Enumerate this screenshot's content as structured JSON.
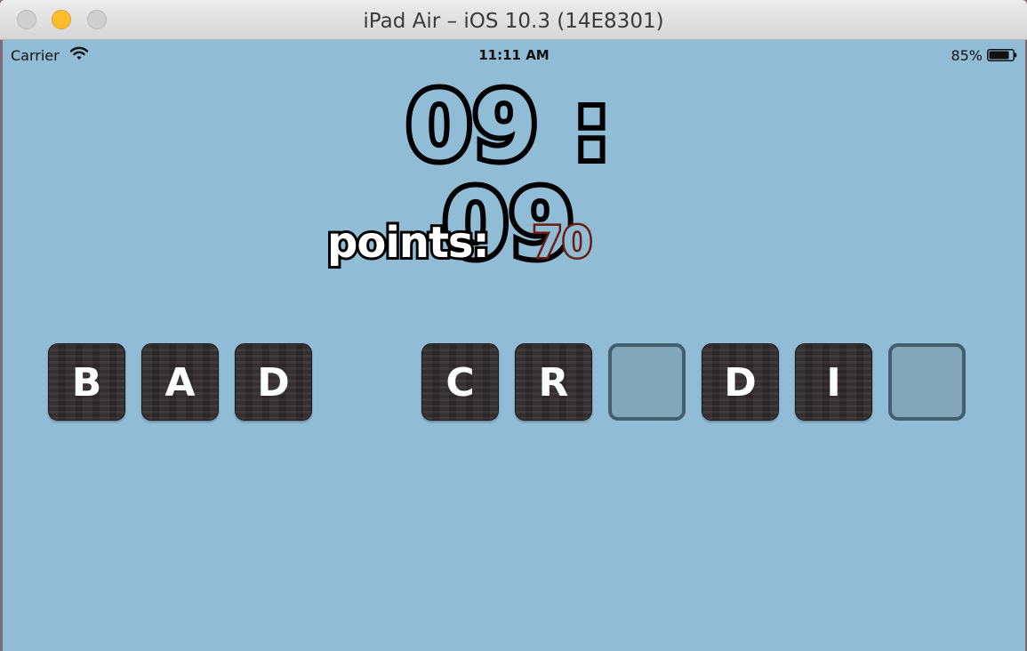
{
  "window": {
    "title": "iPad Air – iOS 10.3 (14E8301)"
  },
  "status_bar": {
    "carrier": "Carrier",
    "time": "11:11 AM",
    "battery": "85%",
    "battery_level": 0.85
  },
  "game": {
    "timer": "09 : 09",
    "points_label": "points:",
    "points_value": "70",
    "source_tiles": [
      {
        "letter": "B"
      },
      {
        "letter": "A"
      },
      {
        "letter": "D"
      }
    ],
    "target_tiles": [
      {
        "letter": "C",
        "filled": true
      },
      {
        "letter": "R",
        "filled": true
      },
      {
        "letter": "",
        "filled": false
      },
      {
        "letter": "D",
        "filled": true
      },
      {
        "letter": "I",
        "filled": true
      },
      {
        "letter": "",
        "filled": false
      }
    ]
  },
  "colors": {
    "background": "#90bcd5",
    "tile": "#322c2d",
    "empty_slot_border": "#445f6c",
    "points_value_stroke": "#6b1c10"
  }
}
